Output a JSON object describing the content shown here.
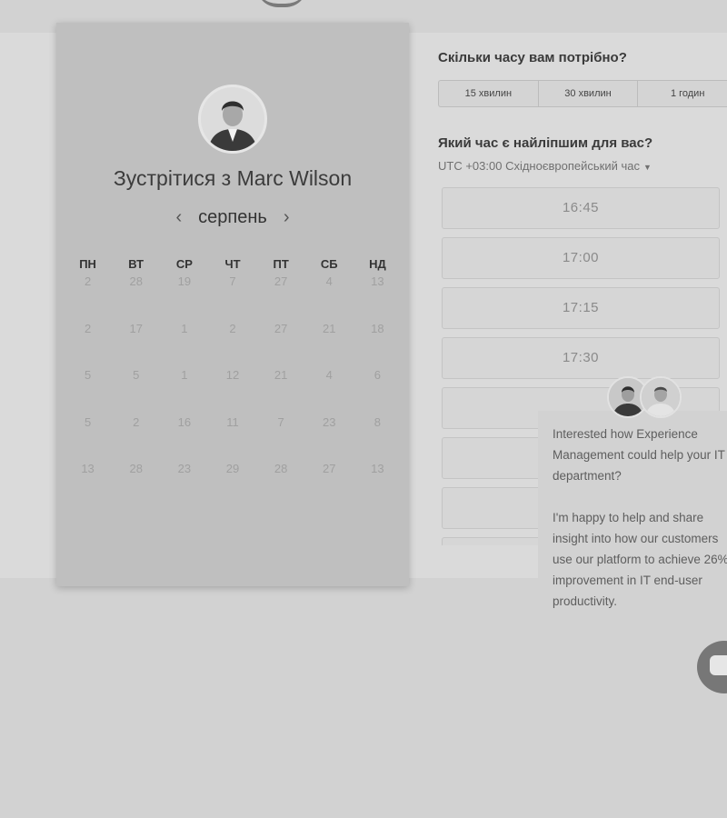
{
  "meeting": {
    "title": "Зустрітися з Marc Wilson",
    "month": "серпень",
    "prev_icon": "‹",
    "next_icon": "›"
  },
  "calendar": {
    "weekdays": [
      "ПН",
      "ВТ",
      "СР",
      "ЧТ",
      "ПТ",
      "СБ",
      "НД"
    ],
    "rows": [
      [
        "2",
        "28",
        "19",
        "7",
        "27",
        "4",
        "13"
      ],
      [
        "2",
        "17",
        "1",
        "2",
        "27",
        "21",
        "18"
      ],
      [
        "5",
        "5",
        "1",
        "12",
        "21",
        "4",
        "6"
      ],
      [
        "5",
        "2",
        "16",
        "11",
        "7",
        "23",
        "8"
      ],
      [
        "13",
        "28",
        "23",
        "29",
        "28",
        "27",
        "13"
      ]
    ]
  },
  "duration": {
    "question": "Скільки часу вам потрібно?",
    "options": [
      "15 хвилин",
      "30 хвилин",
      "1 годин"
    ]
  },
  "time": {
    "question": "Який час є найліпшим для вас?",
    "timezone": "UTC +03:00 Східноєвропейський час",
    "slots": [
      "16:45",
      "17:00",
      "17:15",
      "17:30",
      "",
      "",
      "",
      ""
    ]
  },
  "chat": {
    "paragraph1": "Interested how Experience Management could help your IT department?",
    "paragraph2": "I'm happy to help and share insight into how our customers use our platform to achieve 26% improvement in IT end-user productivity."
  },
  "icons": {
    "prev": "chevron-left-icon",
    "next": "chevron-right-icon",
    "timezone_caret": "caret-down-icon",
    "chat_launcher": "chat-bubble-icon"
  }
}
